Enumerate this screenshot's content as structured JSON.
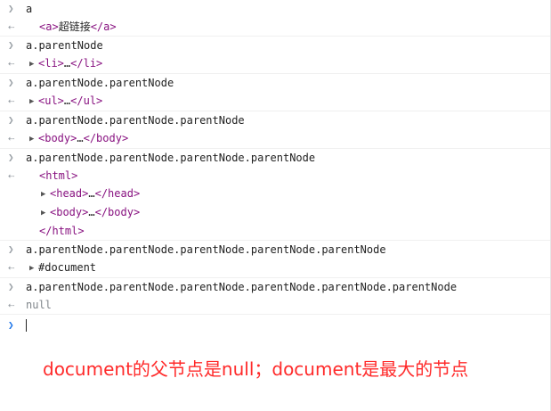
{
  "console": {
    "entries": [
      {
        "cmd": "a",
        "result": {
          "tag_open": "<a>",
          "text": "超链接",
          "tag_close": "</a>"
        }
      },
      {
        "cmd": "a.parentNode",
        "result": {
          "tag_open": "<li>",
          "ellipsis": "…",
          "tag_close": "</li>"
        }
      },
      {
        "cmd": "a.parentNode.parentNode",
        "result": {
          "tag_open": "<ul>",
          "ellipsis": "…",
          "tag_close": "</ul>"
        }
      },
      {
        "cmd": "a.parentNode.parentNode.parentNode",
        "result": {
          "tag_open": "<body>",
          "ellipsis": "…",
          "tag_close": "</body>"
        }
      },
      {
        "cmd": "a.parentNode.parentNode.parentNode.parentNode",
        "result": {
          "open": "<html>",
          "head_open": "<head>",
          "head_ellipsis": "…",
          "head_close": "</head>",
          "body_open": "<body>",
          "body_ellipsis": "…",
          "body_close": "</body>",
          "close": "</html>"
        }
      },
      {
        "cmd": "a.parentNode.parentNode.parentNode.parentNode.parentNode",
        "result": {
          "text": "#document"
        }
      },
      {
        "cmd": "a.parentNode.parentNode.parentNode.parentNode.parentNode.parentNode",
        "result": {
          "text": "null"
        }
      }
    ],
    "input_value": ""
  },
  "annotation": "document的父节点是null；document是最大的节点",
  "colors": {
    "tag": "#881280",
    "prompt_active": "#1a73e8",
    "annotation": "#ff2a2a"
  },
  "icons": {
    "input_prompt": "chevron-right-icon",
    "output_prompt": "return-arrow-icon",
    "expand": "triangle-right-icon"
  }
}
